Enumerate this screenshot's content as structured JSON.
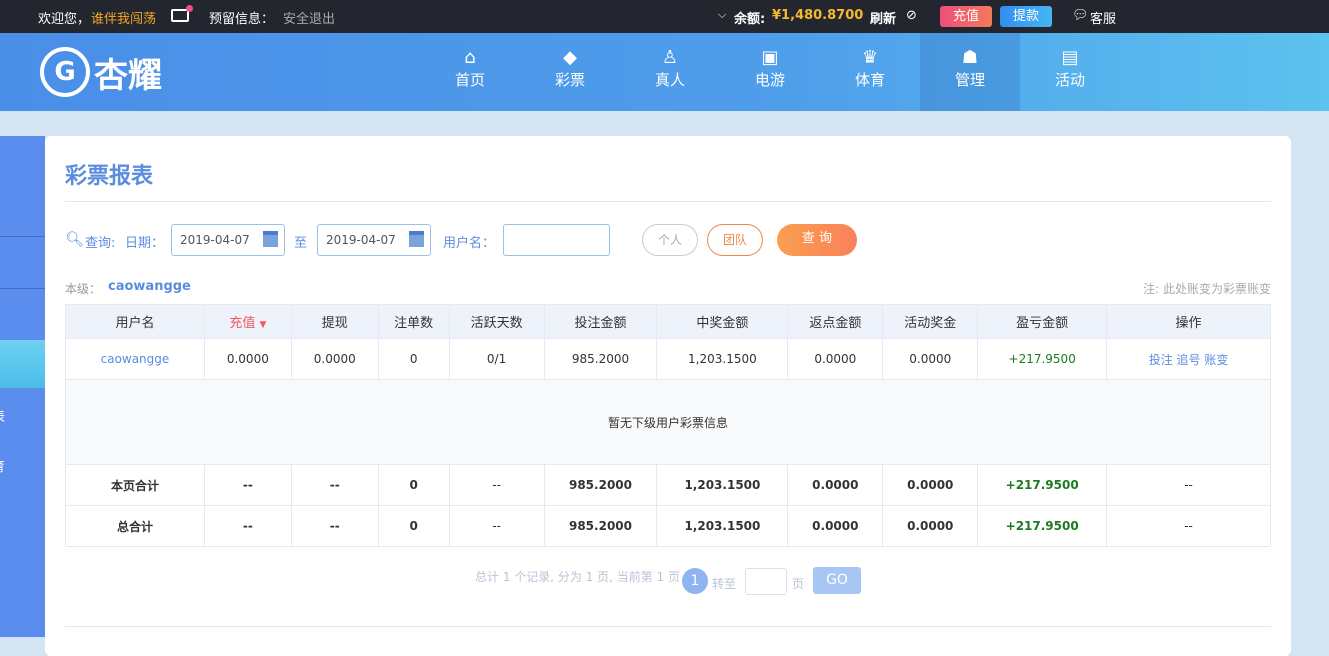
{
  "topbar": {
    "welcome": "欢迎您，",
    "username": "谁伴我闯荡",
    "reserved_label": "预留信息：",
    "logout": "安全退出",
    "balance_label": "余额:",
    "balance": "¥1,480.8700",
    "refresh": "刷新",
    "recharge": "充值",
    "withdraw": "提款",
    "service": "客服"
  },
  "logo": {
    "text": "杏耀",
    "mark": "G"
  },
  "nav": [
    {
      "label": "首页",
      "icon": "⌂"
    },
    {
      "label": "彩票",
      "icon": "◆"
    },
    {
      "label": "真人",
      "icon": "♙"
    },
    {
      "label": "电游",
      "icon": "▣"
    },
    {
      "label": "体育",
      "icon": "♛"
    },
    {
      "label": "管理",
      "icon": "☗"
    },
    {
      "label": "活动",
      "icon": "▤"
    }
  ],
  "sidebar": {
    "partial1": "表",
    "partial2": "育"
  },
  "page": {
    "title": "彩票报表",
    "query_label": "查询:",
    "date_label": "日期：",
    "date_from": "2019-04-07",
    "to": "至",
    "date_to": "2019-04-07",
    "user_label": "用户名：",
    "user_value": "",
    "btn_personal": "个人",
    "btn_team": "团队",
    "btn_query": "查 询",
    "level_label": "本级：",
    "level_user": "caowangge",
    "note": "注: 此处账变为彩票账变"
  },
  "table": {
    "headers": [
      "用户名",
      "充值",
      "提现",
      "注单数",
      "活跃天数",
      "投注金额",
      "中奖金额",
      "返点金额",
      "活动奖金",
      "盈亏金额",
      "操作"
    ],
    "row": [
      "caowangge",
      "0.0000",
      "0.0000",
      "0",
      "0/1",
      "985.2000",
      "1,203.1500",
      "0.0000",
      "0.0000",
      "+217.9500"
    ],
    "actions": [
      "投注",
      "追号",
      "账变"
    ],
    "empty": "暂无下级用户彩票信息",
    "subtotal": [
      "本页合计",
      "--",
      "--",
      "0",
      "--",
      "985.2000",
      "1,203.1500",
      "0.0000",
      "0.0000",
      "+217.9500",
      "--"
    ],
    "total": [
      "总合计",
      "--",
      "--",
      "0",
      "--",
      "985.2000",
      "1,203.1500",
      "0.0000",
      "0.0000",
      "+217.9500",
      "--"
    ]
  },
  "pagination": {
    "summary": "总计 1 个记录, 分为 1 页, 当前第 1 页",
    "current": "1",
    "goto": "转至",
    "page_unit": "页",
    "go": "GO"
  }
}
